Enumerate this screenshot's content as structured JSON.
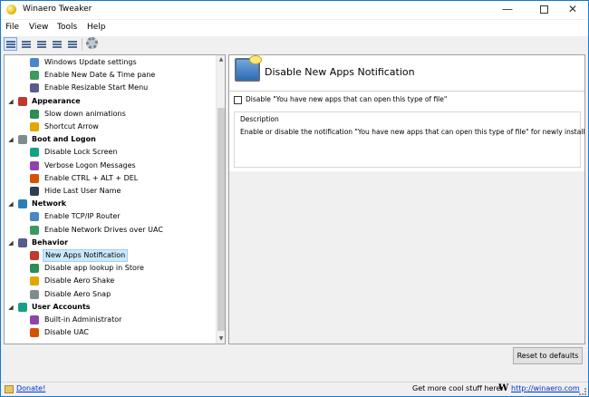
{
  "window": {
    "title": "Winaero Tweaker",
    "controls": {
      "minimize": "—",
      "close": "✕"
    }
  },
  "menu": [
    "File",
    "View",
    "Tools",
    "Help"
  ],
  "toolbar": {
    "buttons": [
      "view-large-icon",
      "view-small-icon",
      "view-list-icon",
      "view-details-icon",
      "view-tiles-icon",
      "settings-gear-icon"
    ],
    "active_index": 0
  },
  "tree": {
    "items": [
      {
        "type": "item",
        "label": "Windows Update settings",
        "icon": "windows-update-icon"
      },
      {
        "type": "item",
        "label": "Enable New Date & Time pane",
        "icon": "calendar-clock-icon"
      },
      {
        "type": "item",
        "label": "Enable Resizable Start Menu",
        "icon": "start-menu-icon"
      },
      {
        "type": "category",
        "label": "Appearance",
        "icon": "paint-palette-icon",
        "expanded": true
      },
      {
        "type": "item",
        "label": "Slow down animations",
        "icon": "animation-icon"
      },
      {
        "type": "item",
        "label": "Shortcut Arrow",
        "icon": "shortcut-arrow-icon"
      },
      {
        "type": "category",
        "label": "Boot and Logon",
        "icon": "boot-spinner-icon",
        "expanded": true
      },
      {
        "type": "item",
        "label": "Disable Lock Screen",
        "icon": "lock-screen-icon"
      },
      {
        "type": "item",
        "label": "Verbose Logon Messages",
        "icon": "warning-icon"
      },
      {
        "type": "item",
        "label": "Enable CTRL + ALT + DEL",
        "icon": "keyboard-icon"
      },
      {
        "type": "item",
        "label": "Hide Last User Name",
        "icon": "user-icon"
      },
      {
        "type": "category",
        "label": "Network",
        "icon": "network-icon",
        "expanded": true
      },
      {
        "type": "item",
        "label": "Enable TCP/IP Router",
        "icon": "router-icon"
      },
      {
        "type": "item",
        "label": "Enable Network Drives over UAC",
        "icon": "network-drive-icon"
      },
      {
        "type": "category",
        "label": "Behavior",
        "icon": "behavior-folder-icon",
        "expanded": true
      },
      {
        "type": "item",
        "label": "New Apps Notification",
        "icon": "notification-icon",
        "selected": true
      },
      {
        "type": "item",
        "label": "Disable app lookup in Store",
        "icon": "store-icon"
      },
      {
        "type": "item",
        "label": "Disable Aero Shake",
        "icon": "aero-shake-icon"
      },
      {
        "type": "item",
        "label": "Disable Aero Snap",
        "icon": "aero-snap-icon"
      },
      {
        "type": "category",
        "label": "User Accounts",
        "icon": "users-icon",
        "expanded": true
      },
      {
        "type": "item",
        "label": "Built-in Administrator",
        "icon": "admin-user-icon"
      },
      {
        "type": "item",
        "label": "Disable UAC",
        "icon": "uac-shield-icon"
      }
    ]
  },
  "panel": {
    "title": "Disable New Apps Notification",
    "icon": "monitor-notification-icon",
    "checkbox": {
      "label": "Disable \"You have new apps that can open this type of file\"",
      "checked": false
    },
    "description_title": "Description",
    "description_text": "Enable or disable the notification \"You have new apps that can open this type of file\" for newly installed apps."
  },
  "reset_button": "Reset to defaults",
  "status": {
    "donate": "Donate!",
    "more": "Get more cool stuff here:",
    "logo": "W",
    "link": "http://winaero.com"
  },
  "colors": {
    "window_border": "#1979ca",
    "selection_bg": "#cce8ff",
    "link": "#0033cc"
  }
}
